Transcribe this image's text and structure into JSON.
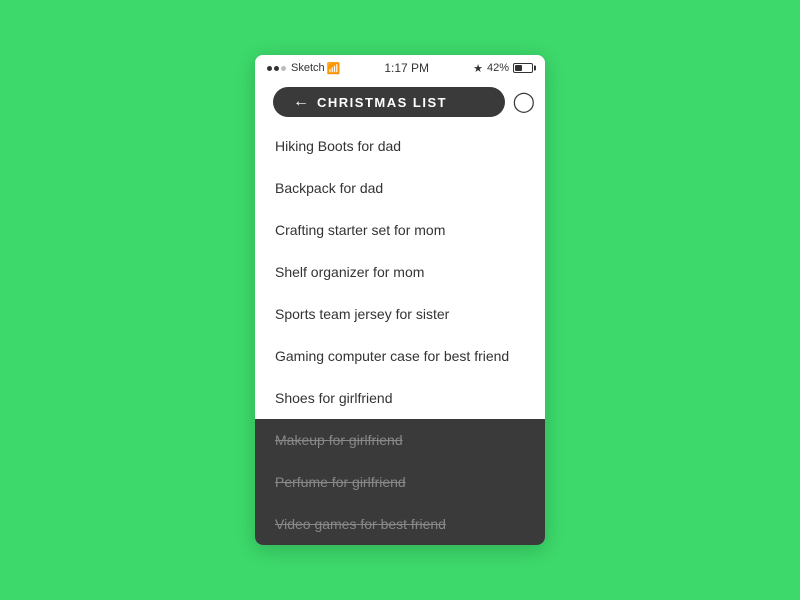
{
  "statusBar": {
    "time": "1:17 PM",
    "carrier": "Sketch",
    "wifi": "WiFi",
    "bluetooth": "BT",
    "battery": "42%"
  },
  "nav": {
    "title": "CHRISTMAS LIST",
    "backLabel": "←",
    "clockIcon": "🕐"
  },
  "listItems": [
    {
      "id": 1,
      "text": "Hiking Boots for dad",
      "completed": false
    },
    {
      "id": 2,
      "text": "Backpack for dad",
      "completed": false
    },
    {
      "id": 3,
      "text": "Crafting starter set for mom",
      "completed": false
    },
    {
      "id": 4,
      "text": "Shelf organizer for mom",
      "completed": false
    },
    {
      "id": 5,
      "text": "Sports team jersey for sister",
      "completed": false
    },
    {
      "id": 6,
      "text": "Gaming computer case for best friend",
      "completed": false
    },
    {
      "id": 7,
      "text": "Shoes for girlfriend",
      "completed": false
    }
  ],
  "completedItems": [
    {
      "id": 8,
      "text": "Makeup for girlfriend",
      "completed": true
    },
    {
      "id": 9,
      "text": "Perfume for girlfriend",
      "completed": true
    },
    {
      "id": 10,
      "text": "Video games for best friend",
      "completed": true
    }
  ]
}
